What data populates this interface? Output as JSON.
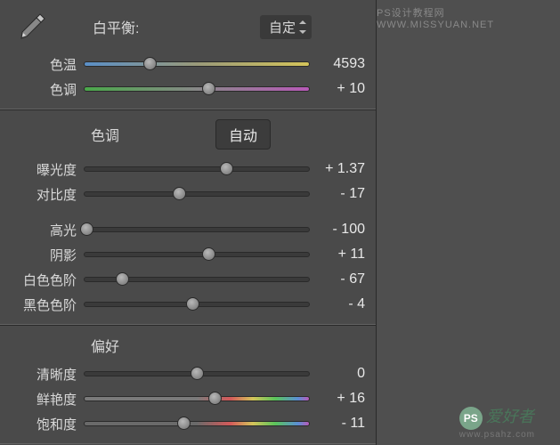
{
  "wb": {
    "header_label": "白平衡:",
    "mode": "自定",
    "temp": {
      "label": "色温",
      "value": "4593",
      "pos": 29
    },
    "tint": {
      "label": "色调",
      "value": "+ 10",
      "pos": 55
    }
  },
  "tone": {
    "header_label": "色调",
    "auto_label": "自动",
    "exposure": {
      "label": "曝光度",
      "value": "+ 1.37",
      "pos": 63
    },
    "contrast": {
      "label": "对比度",
      "value": "- 17",
      "pos": 42
    },
    "highlights": {
      "label": "高光",
      "value": "- 100",
      "pos": 1
    },
    "shadows": {
      "label": "阴影",
      "value": "+ 11",
      "pos": 55
    },
    "whites": {
      "label": "白色色阶",
      "value": "- 67",
      "pos": 17
    },
    "blacks": {
      "label": "黑色色阶",
      "value": "- 4",
      "pos": 48
    }
  },
  "presence": {
    "header_label": "偏好",
    "clarity": {
      "label": "清晰度",
      "value": "0",
      "pos": 50
    },
    "vibrance": {
      "label": "鲜艳度",
      "value": "+ 16",
      "pos": 58
    },
    "saturation": {
      "label": "饱和度",
      "value": "- 11",
      "pos": 44
    }
  },
  "watermarks": {
    "top": "PS设计教程网　WWW.MISSYUAN.NET",
    "bottom_zh": "爱好者",
    "bottom_en": "www.psahz.com",
    "logo": "PS"
  }
}
